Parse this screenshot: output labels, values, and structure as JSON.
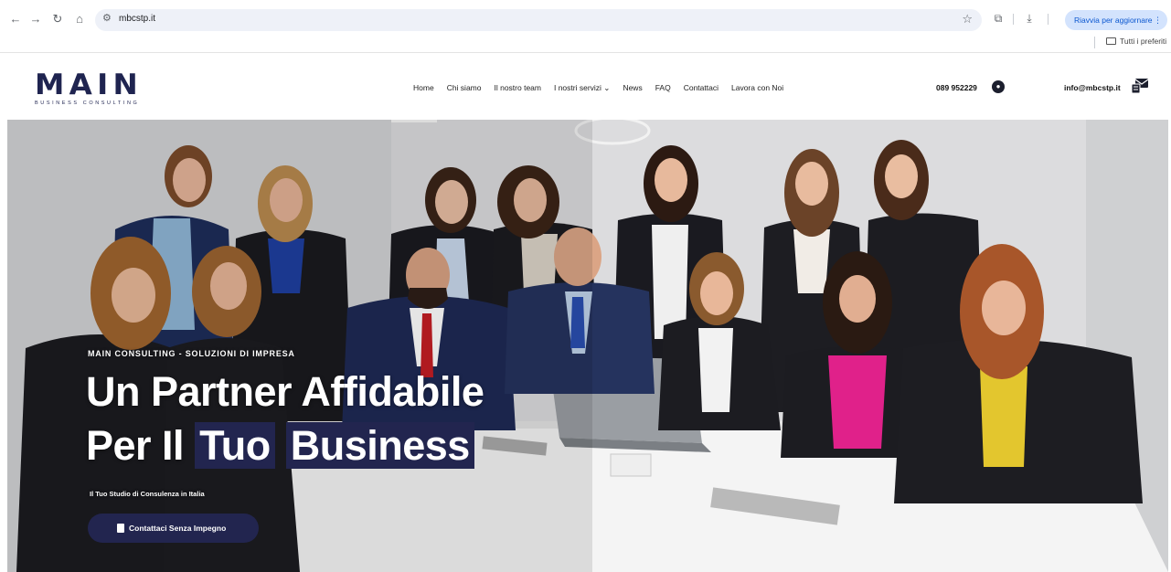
{
  "browser": {
    "url": "mbcstp.it",
    "update_button": "Riavvia per aggiornare",
    "bookmark_folder": "Tutti i preferiti"
  },
  "logo": {
    "main": "MAIN",
    "sub": "BUSINESS CONSULTING"
  },
  "nav": {
    "items": [
      "Home",
      "Chi siamo",
      "Il nostro team",
      "I nostri servizi ⌄",
      "News",
      "FAQ",
      "Contattaci",
      "Lavora con Noi"
    ]
  },
  "contact": {
    "phone": "089 952229",
    "email": "info@mbcstp.it"
  },
  "hero": {
    "kicker": "MAIN CONSULTING - SOLUZIONI DI IMPRESA",
    "title_line1": "Un Partner Affidabile",
    "title_line2_plain": "Per Il",
    "title_line2_hl1": "Tuo",
    "title_line2_hl2": "Business",
    "subtitle": "Il Tuo Studio di Consulenza in Italia",
    "cta_label": "Contattaci Senza Impegno"
  },
  "colors": {
    "brand_navy": "#22254f",
    "omnibox_bg": "#eef1f8",
    "update_bg": "#d3e3fd"
  },
  "icons": [
    "back-icon",
    "forward-icon",
    "reload-icon",
    "home-icon",
    "site-settings-icon",
    "bookmark-star-icon",
    "extensions-icon",
    "download-icon",
    "more-icon",
    "folder-icon",
    "user-circle-icon",
    "email-icon",
    "document-icon"
  ]
}
